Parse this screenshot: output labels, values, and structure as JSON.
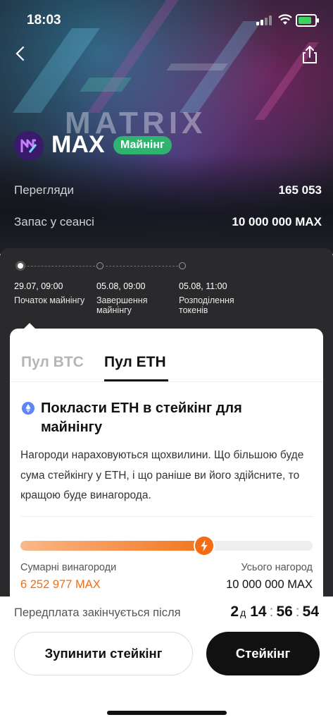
{
  "status_bar": {
    "time": "18:03"
  },
  "hero": {
    "watermark": "MATRIX",
    "token": "MAX",
    "badge": "Майнінг",
    "stats": [
      {
        "label": "Перегляди",
        "value": "165 053"
      },
      {
        "label": "Запас у сеансі",
        "value": "10 000 000 MAX"
      }
    ]
  },
  "timeline": [
    {
      "date": "29.07, 09:00",
      "name": "Початок майнінгу",
      "active": true
    },
    {
      "date": "05.08, 09:00",
      "name": "Завершення майнінгу",
      "active": false
    },
    {
      "date": "05.08, 11:00",
      "name": "Розподілення токенів",
      "active": false
    }
  ],
  "tabs": {
    "btc": "Пул BTC",
    "eth": "Пул ETH",
    "selected": "eth"
  },
  "card": {
    "title": "Покласти ETH в стейкінг для майнінгу",
    "description": "Нагороди нараховуються щохвилини. Що більшою буде сума стейкінгу у ETH, і що раніше ви його здійсните, то кращою буде винагорода.",
    "progress": 0.63,
    "total_rewards_label": "Сумарні винагороди",
    "total_rewards_value": "6 252 977 MAX",
    "all_rewards_label": "Усього нагород",
    "all_rewards_value": "10 000 000 MAX",
    "accent_color": "#f26d16"
  },
  "footer": {
    "presale_label": "Передплата закінчується після",
    "countdown": {
      "days": "2",
      "days_unit": "д",
      "hours": "14",
      "minutes": "56",
      "seconds": "54"
    },
    "stop_button": "Зупинити стейкінг",
    "stake_button": "Стейкінг"
  }
}
